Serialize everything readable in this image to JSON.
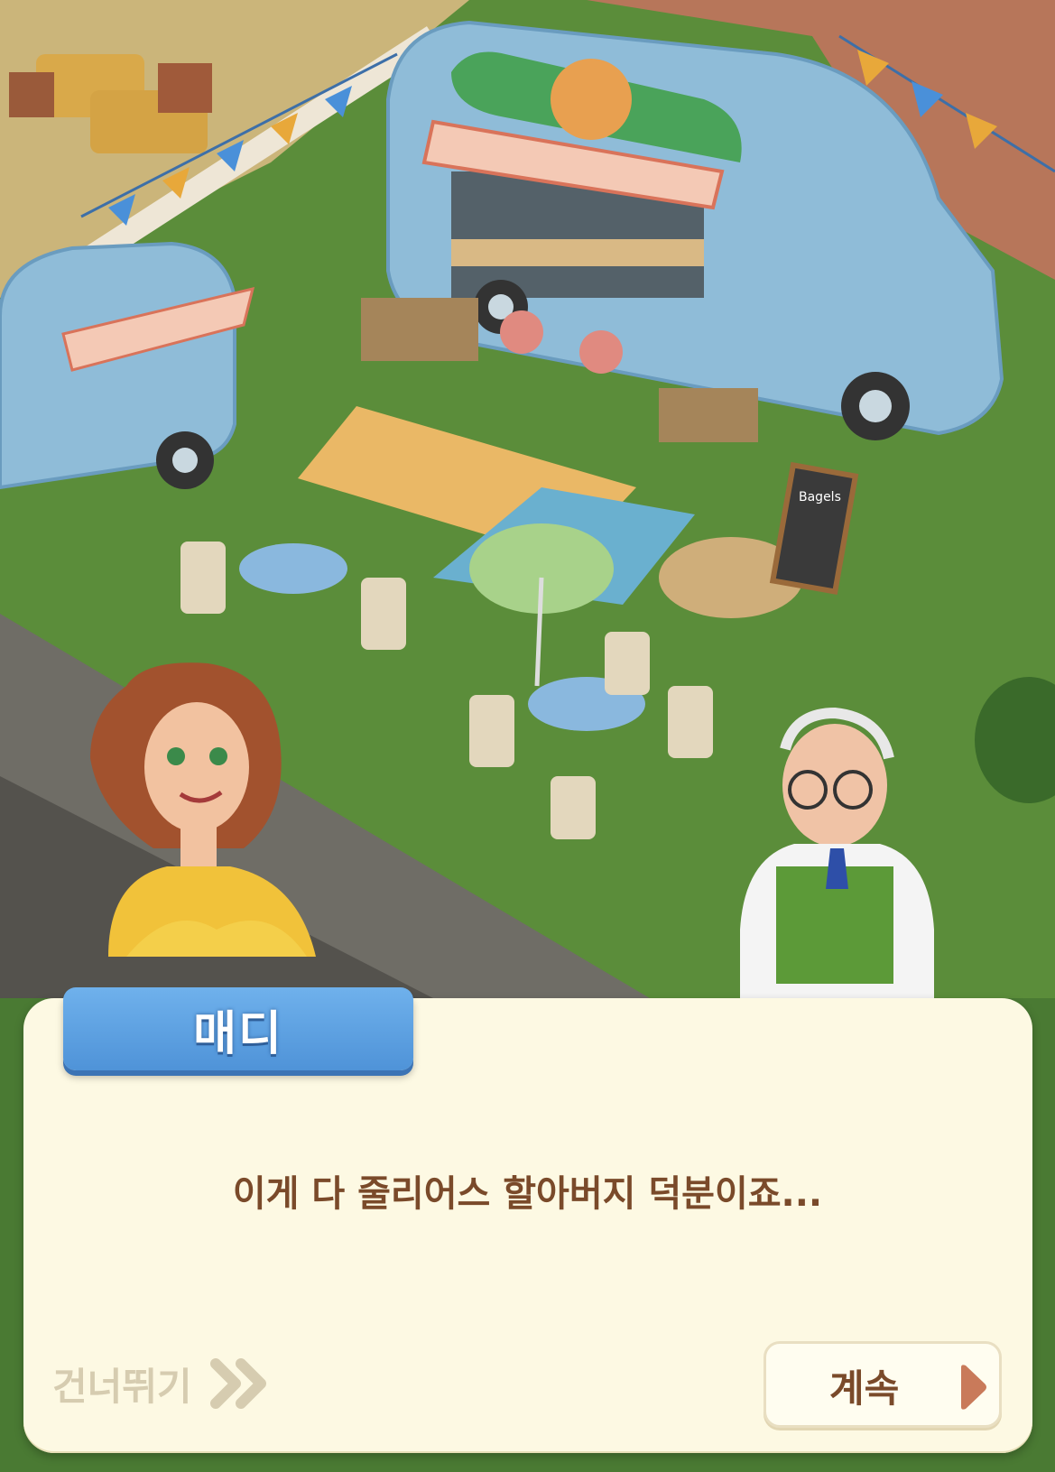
{
  "dialog": {
    "speaker": "매디",
    "text": "이게 다 줄리어스 할아버지 덕분이죠...",
    "skip_label": "건너뛰기",
    "continue_label": "계속"
  },
  "scene": {
    "menu_board_text": "Bagels"
  },
  "colors": {
    "name_plate": "#5a9fe0",
    "dialog_bg": "#fdf9e3",
    "dialog_text": "#7a4a2a",
    "skip_text": "#d6ccb0",
    "arrow": "#c97a5a"
  },
  "icons": {
    "skip": "double-chevron-right-icon",
    "continue": "play-arrow-icon"
  }
}
